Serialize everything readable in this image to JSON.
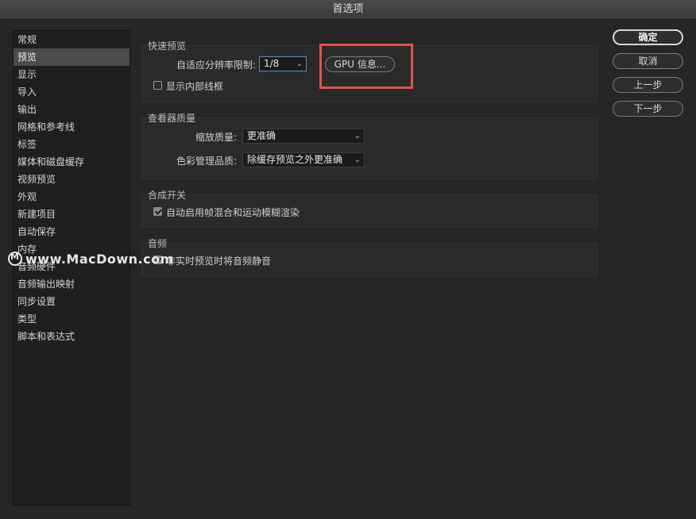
{
  "window": {
    "title": "首选项"
  },
  "sidebar": {
    "items": [
      {
        "label": "常规"
      },
      {
        "label": "预览"
      },
      {
        "label": "显示"
      },
      {
        "label": "导入"
      },
      {
        "label": "输出"
      },
      {
        "label": "网格和参考线"
      },
      {
        "label": "标签"
      },
      {
        "label": "媒体和磁盘缓存"
      },
      {
        "label": "视频预览"
      },
      {
        "label": "外观"
      },
      {
        "label": "新建项目"
      },
      {
        "label": "自动保存"
      },
      {
        "label": "内存"
      },
      {
        "label": "音频硬件"
      },
      {
        "label": "音频输出映射"
      },
      {
        "label": "同步设置"
      },
      {
        "label": "类型"
      },
      {
        "label": "脚本和表达式"
      }
    ],
    "selected_label": "预览"
  },
  "fast_preview": {
    "title": "快速预览",
    "resolution_label": "自适应分辨率限制:",
    "resolution_value": "1/8",
    "gpu_button": "GPU 信息...",
    "show_wireframe_label": "显示内部线框",
    "show_wireframe_checked": false
  },
  "viewer_quality": {
    "title": "查看器质量",
    "zoom_label": "缩放质量:",
    "zoom_value": "更准确",
    "color_label": "色彩管理品质:",
    "color_value": "除缓存预览之外更准确"
  },
  "compositing": {
    "title": "合成开关",
    "auto_blend_label": "自动启用帧混合和运动模糊渲染",
    "auto_blend_checked": true
  },
  "audio": {
    "title": "音频",
    "mute_label": "非实时预览时将音频静音",
    "mute_checked": true
  },
  "buttons": {
    "ok": "确定",
    "cancel": "取消",
    "prev": "上一步",
    "next": "下一步"
  },
  "watermark": {
    "text": "www.MacDown.com"
  },
  "colors": {
    "background": "#262626",
    "selected_item": "#4b4b4b",
    "highlight_box": "#e0514a",
    "focus_blue": "#5b8cc8"
  }
}
